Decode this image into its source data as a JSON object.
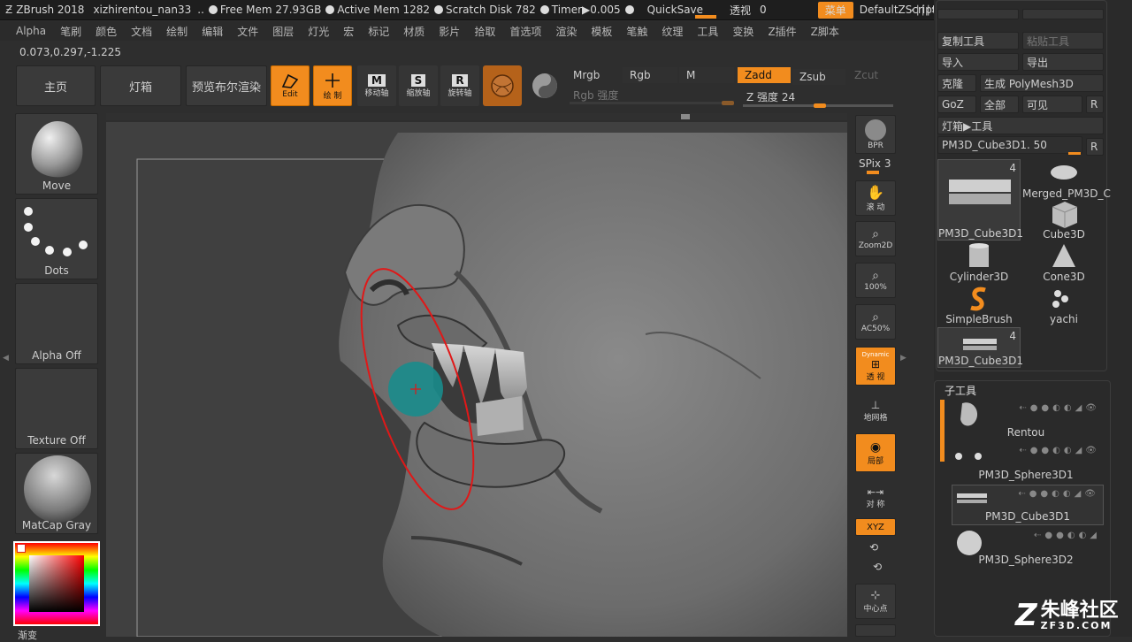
{
  "titlebar": {
    "app": "ZBrush 2018",
    "file": "xizhirentou_nan33",
    "ellipsis": "..",
    "free_mem": "Free Mem 27.93GB",
    "active_mem": "Active Mem 1282",
    "scratch": "Scratch Disk 782",
    "timer": "Timer▶0.005",
    "quicksave": "QuickSave",
    "transparency": "透视",
    "transparency_value": "0",
    "menu": "菜单",
    "script": "DefaultZScript",
    "win_controls": [
      "‹∣∣∣›",
      "?",
      "▭",
      "⧉",
      "≡",
      "—",
      "□",
      "✕"
    ]
  },
  "menubar": [
    "Alpha",
    "笔刷",
    "颜色",
    "文档",
    "绘制",
    "编辑",
    "文件",
    "图层",
    "灯光",
    "宏",
    "标记",
    "材质",
    "影片",
    "拾取",
    "首选项",
    "渲染",
    "模板",
    "笔触",
    "纹理",
    "工具",
    "变换",
    "Z插件",
    "Z脚本"
  ],
  "coords": "0.073,0.297,-1.225",
  "shelf": {
    "home": "主页",
    "lightbox": "灯箱",
    "preview": "预览布尔渲染",
    "tools": [
      {
        "label": "Edit",
        "icon": "edit-icon",
        "active": true
      },
      {
        "label": "绘 制",
        "icon": "draw-icon",
        "active": true
      },
      {
        "label": "移动轴",
        "icon": "move-axis-icon",
        "active": false,
        "key": "M"
      },
      {
        "label": "缩放轴",
        "icon": "scale-axis-icon",
        "active": false,
        "key": "S"
      },
      {
        "label": "旋转轴",
        "icon": "rotate-axis-icon",
        "active": false,
        "key": "R"
      }
    ],
    "mrgb": "Mrgb",
    "rgb": "Rgb",
    "m": "M",
    "zadd": "Zadd",
    "zsub": "Zsub",
    "zcut": "Zcut",
    "rgb_intensity": "Rgb 强度",
    "z_intensity": "Z 强度 24"
  },
  "left_tray": {
    "brush": "Move",
    "stroke": "Dots",
    "alpha": "Alpha Off",
    "texture": "Texture Off",
    "material": "MatCap Gray",
    "gradient": "渐变"
  },
  "right_shelf": {
    "bpr": "BPR",
    "spix": "SPix 3",
    "scroll": "滚 动",
    "zoom2d": "Zoom2D",
    "zoom100": "100%",
    "ac50": "AC50%",
    "dynamic": "Dynamic",
    "perspective": "透 视",
    "floor": "地网格",
    "local": "局部",
    "symmetry": "对 称",
    "xyz": "XYZ",
    "center": "中心点"
  },
  "right_panel": {
    "copy_tool": "复制工具",
    "paste_tool": "粘贴工具",
    "import": "导入",
    "export": "导出",
    "clone": "克隆",
    "make_polymesh": "生成 PolyMesh3D",
    "goz": "GoZ",
    "all": "全部",
    "visible": "可见",
    "r": "R",
    "lightbox_tools": "灯箱▶工具",
    "current_tool": "PM3D_Cube3D1. 50",
    "tools": [
      {
        "name": "PM3D_Cube3D1",
        "count": "4"
      },
      {
        "name": "Merged_PM3D_C",
        "count": ""
      },
      {
        "name": "Cube3D",
        "count": ""
      },
      {
        "name": "Cylinder3D",
        "count": ""
      },
      {
        "name": "Cone3D",
        "count": ""
      },
      {
        "name": "SimpleBrush",
        "count": ""
      },
      {
        "name": "yachi",
        "count": ""
      },
      {
        "name": "PM3D_Cube3D1",
        "count": "4"
      }
    ],
    "subtool_title": "子工具",
    "subtools": [
      "Rentou",
      "PM3D_Sphere3D1",
      "PM3D_Cube3D1",
      "PM3D_Sphere3D2"
    ]
  },
  "watermark": {
    "brand": "朱峰社区",
    "url": "ZF3D.COM"
  },
  "colors": {
    "accent": "#f28c1e",
    "bg": "#2e2e2e",
    "canvas": "#404040",
    "cursor": "#1a8c8c",
    "brush_ring": "#e01818"
  }
}
